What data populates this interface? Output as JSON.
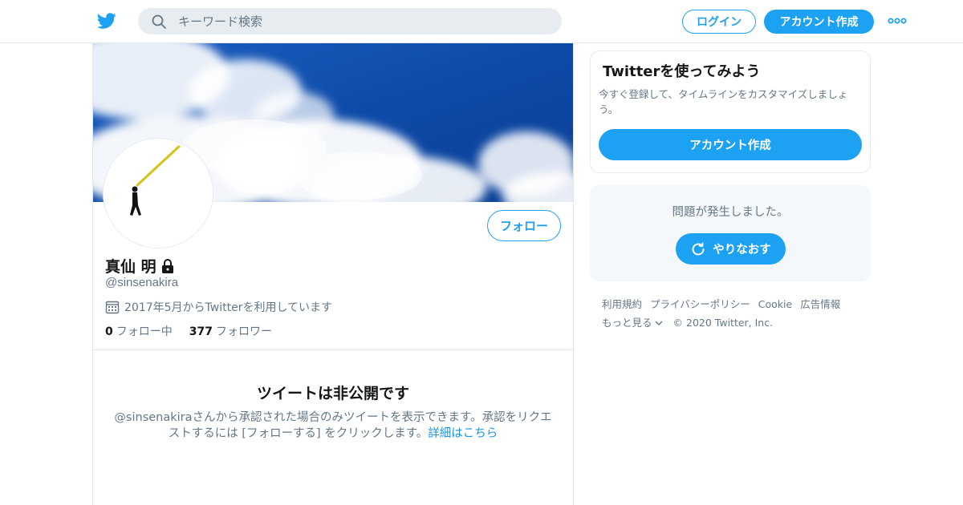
{
  "colors": {
    "accent": "#1da1f2",
    "link": "#1b95e0",
    "text": "#14171a",
    "muted": "#657786",
    "border": "#e1e8ed",
    "sky": "#0d4aa8"
  },
  "header": {
    "logo_icon": "twitter-bird-icon",
    "search_placeholder": "キーワード検索",
    "search_icon": "search-icon",
    "login_label": "ログイン",
    "signup_label": "アカウント作成",
    "more_icon": "more-dots-icon"
  },
  "profile": {
    "display_name": "真仙 明",
    "lock_icon": "lock-icon",
    "handle": "@sinsenakira",
    "calendar_icon": "calendar-icon",
    "joined": "2017年5月からTwitterを利用しています",
    "follow_label": "フォロー",
    "following_count": "0",
    "following_label": "フォロー中",
    "followers_count": "377",
    "followers_label": "フォロワー"
  },
  "protected": {
    "title": "ツイートは非公開です",
    "description": "@sinsenakiraさんから承認された場合のみツイートを表示できます。承認をリクエストするには [フォローする] をクリックします。",
    "link_label": "詳細はこちら"
  },
  "sidebar": {
    "signup_card": {
      "title": "Twitterを使ってみよう",
      "description": "今すぐ登録して、タイムラインをカスタマイズしましょう。",
      "button_label": "アカウント作成"
    },
    "error_card": {
      "message": "問題が発生しました。",
      "retry_label": "やりなおす",
      "retry_icon": "refresh-icon"
    },
    "footer": {
      "links": [
        "利用規約",
        "プライバシーポリシー",
        "Cookie",
        "広告情報"
      ],
      "more_label": "もっと見る",
      "copyright": "© 2020 Twitter, Inc."
    }
  }
}
